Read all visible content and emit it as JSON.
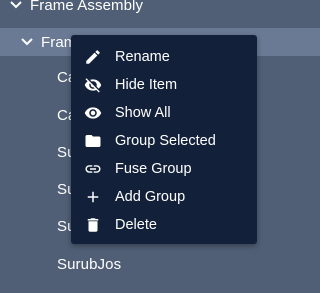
{
  "tree": {
    "root_label": "Frame Assembly",
    "selected_label": "Frame",
    "children": [
      "Ca",
      "Ca",
      "Surub",
      "Su",
      "Su",
      "SurubJos"
    ]
  },
  "menu": {
    "items": [
      {
        "label": "Rename",
        "icon": "pencil-icon"
      },
      {
        "label": "Hide Item",
        "icon": "eye-off-icon"
      },
      {
        "label": "Show All",
        "icon": "eye-icon"
      },
      {
        "label": "Group Selected",
        "icon": "folder-icon"
      },
      {
        "label": "Fuse Group",
        "icon": "link-icon"
      },
      {
        "label": "Add Group",
        "icon": "plus-icon"
      },
      {
        "label": "Delete",
        "icon": "trash-icon"
      }
    ]
  },
  "colors": {
    "panel_bg": "#505f76",
    "selected_row_bg": "#6a7a94",
    "menu_bg": "#12203a",
    "text": "#ffffff"
  }
}
